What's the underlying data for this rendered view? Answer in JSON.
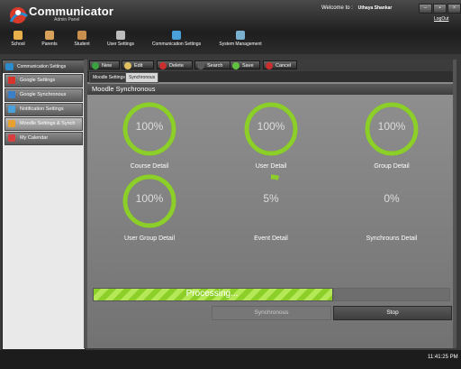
{
  "app": {
    "brand": "Communicator",
    "subtitle": "Admin Panel",
    "welcome_label": "Welcome to :",
    "user_name": "Uthaya Shankar",
    "logout": "LogOut",
    "window_buttons": [
      "–",
      "▪",
      "×"
    ]
  },
  "nav": [
    {
      "label": "School",
      "icon": "school-icon",
      "color": "#e8b04a"
    },
    {
      "label": "Parents",
      "icon": "parents-icon",
      "color": "#d9a25a"
    },
    {
      "label": "Student",
      "icon": "student-icon",
      "color": "#c98f4e"
    },
    {
      "label": "User Settings",
      "icon": "user-settings-icon",
      "color": "#bcbcbc"
    },
    {
      "label": "Communication Settings",
      "icon": "communication-settings-icon",
      "color": "#4aa0d8"
    },
    {
      "label": "System Management",
      "icon": "system-management-icon",
      "color": "#7ab0d0"
    }
  ],
  "sidebar": {
    "header": "Communication Settings",
    "items": [
      {
        "label": "Google Settings",
        "icon": "google-icon",
        "color": "#d9342b"
      },
      {
        "label": "Google Synchronous",
        "icon": "google-sync-icon",
        "color": "#3a7fc8"
      },
      {
        "label": "Notification Settings",
        "icon": "notification-icon",
        "color": "#4aa0d8"
      },
      {
        "label": "Moodle Settings & Synch",
        "icon": "moodle-icon",
        "color": "#e8a030"
      },
      {
        "label": "My Calendar",
        "icon": "calendar-icon",
        "color": "#d84040"
      }
    ]
  },
  "toolbar": {
    "new": "New",
    "edit": "Edit",
    "delete": "Delete",
    "search": "Search",
    "save": "Save",
    "cancel": "Cancel"
  },
  "tabs": [
    "Moodle Settings",
    "Synchronous"
  ],
  "section_title": "Moodle Synchronous",
  "gauges": [
    {
      "value": "100%",
      "label": "Course Detail",
      "fill": 1.0
    },
    {
      "value": "100%",
      "label": "User Detail",
      "fill": 1.0
    },
    {
      "value": "100%",
      "label": "Group Detail",
      "fill": 1.0
    },
    {
      "value": "100%",
      "label": "User Group Detail",
      "fill": 1.0
    },
    {
      "value": "5%",
      "label": "Event Detail",
      "fill": 0.05
    },
    {
      "value": "0%",
      "label": "Synchrouns Detail",
      "fill": 0.0
    }
  ],
  "progress": {
    "text": "Processing...",
    "fraction": 0.67
  },
  "buttons": {
    "synchronous": "Synchronous",
    "stop": "Stop"
  },
  "status": {
    "time": "11:41:25 PM"
  },
  "colors": {
    "accent": "#8ccf28",
    "gauge_ring": "#8ccf28"
  }
}
